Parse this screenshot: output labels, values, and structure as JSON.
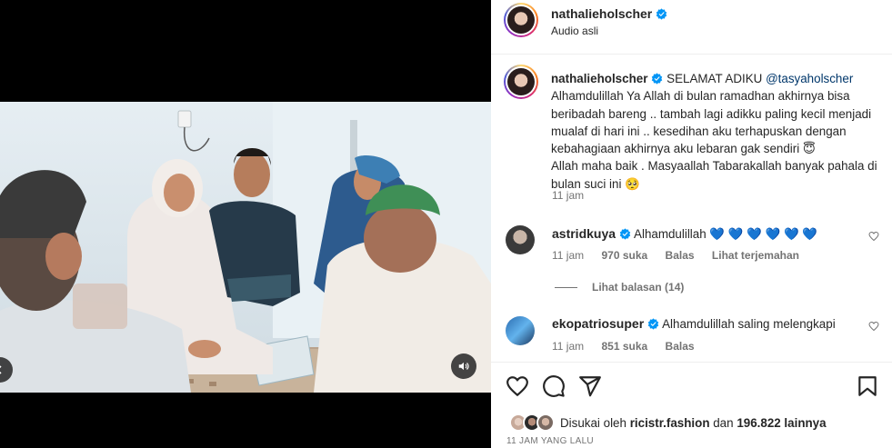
{
  "post": {
    "username": "nathalieholscher",
    "audio": "Audio asli"
  },
  "caption": {
    "username": "nathalieholscher",
    "lead": "SELAMAT ADIKU",
    "mention": "@tasyaholscher",
    "body": "Alhamdulillah Ya Allah di bulan ramadhan akhirnya bisa beribadah bareng .. tambah lagi adikku paling kecil menjadi mualaf di hari ini .. kesedihan aku terhapuskan dengan kebahagiaan akhirnya aku lebaran gak sendiri 😇",
    "body2": "Allah maha baik . Masyaallah Tabarakallah banyak pahala di bulan suci ini 🥺",
    "time": "11 jam"
  },
  "comments": [
    {
      "username": "astridkuya",
      "text": "Alhamdulillah 💙 💙 💙 💙 💙 💙",
      "time": "11 jam",
      "likes": "970 suka",
      "reply": "Balas",
      "translate": "Lihat terjemahan"
    },
    {
      "username": "ekopatriosuper",
      "text": "Alhamdulillah saling melengkapi",
      "time": "11 jam",
      "likes": "851 suka",
      "reply": "Balas"
    }
  ],
  "view_replies": "Lihat balasan (14)",
  "likes": {
    "prefix": "Disukai oleh",
    "user": "ricistr.fashion",
    "mid": "dan",
    "count": "196.822 lainnya"
  },
  "post_time": "11 JAM YANG LALU",
  "icons": {
    "verified": "verified-badge-icon",
    "like": "heart-icon",
    "comment": "comment-icon",
    "share": "share-icon",
    "save": "bookmark-icon",
    "audio": "speaker-icon"
  },
  "colors": {
    "verified": "#0095f6",
    "link": "#00376b",
    "muted": "#737373",
    "text": "#262626"
  }
}
